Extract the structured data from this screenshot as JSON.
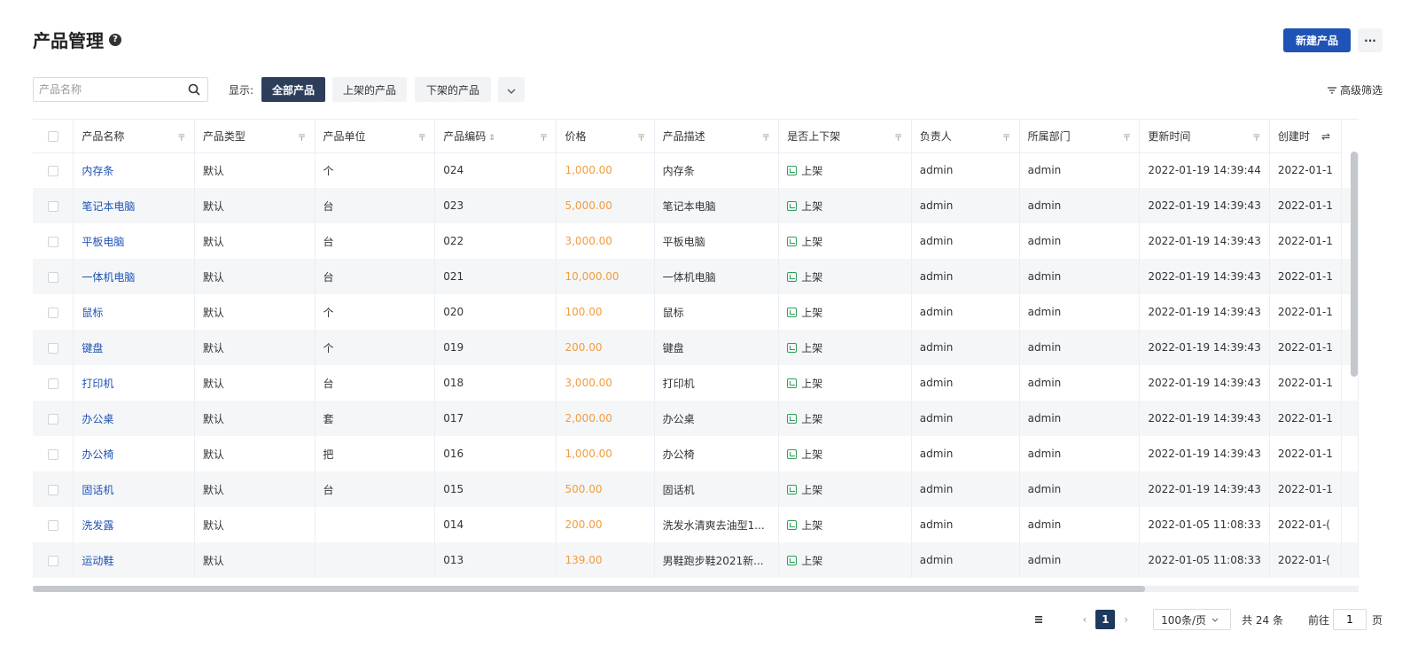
{
  "header": {
    "title": "产品管理",
    "new_button": "新建产品",
    "more_button": "···"
  },
  "toolbar": {
    "search_placeholder": "产品名称",
    "filter_label": "显示:",
    "filters": [
      "全部产品",
      "上架的产品",
      "下架的产品"
    ],
    "advanced_filter": "高级筛选"
  },
  "table": {
    "columns": [
      "产品名称",
      "产品类型",
      "产品单位",
      "产品编码",
      "价格",
      "产品描述",
      "是否上下架",
      "负责人",
      "所属部门",
      "更新时间",
      "创建时"
    ],
    "rows": [
      {
        "name": "内存条",
        "type": "默认",
        "unit": "个",
        "code": "024",
        "price": "1,000.00",
        "desc": "内存条",
        "status": "上架",
        "owner": "admin",
        "dept": "admin",
        "updated": "2022-01-19 14:39:44",
        "created": "2022-01-1"
      },
      {
        "name": "笔记本电脑",
        "type": "默认",
        "unit": "台",
        "code": "023",
        "price": "5,000.00",
        "desc": "笔记本电脑",
        "status": "上架",
        "owner": "admin",
        "dept": "admin",
        "updated": "2022-01-19 14:39:43",
        "created": "2022-01-1"
      },
      {
        "name": "平板电脑",
        "type": "默认",
        "unit": "台",
        "code": "022",
        "price": "3,000.00",
        "desc": "平板电脑",
        "status": "上架",
        "owner": "admin",
        "dept": "admin",
        "updated": "2022-01-19 14:39:43",
        "created": "2022-01-1"
      },
      {
        "name": "一体机电脑",
        "type": "默认",
        "unit": "台",
        "code": "021",
        "price": "10,000.00",
        "desc": "一体机电脑",
        "status": "上架",
        "owner": "admin",
        "dept": "admin",
        "updated": "2022-01-19 14:39:43",
        "created": "2022-01-1"
      },
      {
        "name": "鼠标",
        "type": "默认",
        "unit": "个",
        "code": "020",
        "price": "100.00",
        "desc": "鼠标",
        "status": "上架",
        "owner": "admin",
        "dept": "admin",
        "updated": "2022-01-19 14:39:43",
        "created": "2022-01-1"
      },
      {
        "name": "键盘",
        "type": "默认",
        "unit": "个",
        "code": "019",
        "price": "200.00",
        "desc": "键盘",
        "status": "上架",
        "owner": "admin",
        "dept": "admin",
        "updated": "2022-01-19 14:39:43",
        "created": "2022-01-1"
      },
      {
        "name": "打印机",
        "type": "默认",
        "unit": "台",
        "code": "018",
        "price": "3,000.00",
        "desc": "打印机",
        "status": "上架",
        "owner": "admin",
        "dept": "admin",
        "updated": "2022-01-19 14:39:43",
        "created": "2022-01-1"
      },
      {
        "name": "办公桌",
        "type": "默认",
        "unit": "套",
        "code": "017",
        "price": "2,000.00",
        "desc": "办公桌",
        "status": "上架",
        "owner": "admin",
        "dept": "admin",
        "updated": "2022-01-19 14:39:43",
        "created": "2022-01-1"
      },
      {
        "name": "办公椅",
        "type": "默认",
        "unit": "把",
        "code": "016",
        "price": "1,000.00",
        "desc": "办公椅",
        "status": "上架",
        "owner": "admin",
        "dept": "admin",
        "updated": "2022-01-19 14:39:43",
        "created": "2022-01-1"
      },
      {
        "name": "固话机",
        "type": "默认",
        "unit": "台",
        "code": "015",
        "price": "500.00",
        "desc": "固话机",
        "status": "上架",
        "owner": "admin",
        "dept": "admin",
        "updated": "2022-01-19 14:39:43",
        "created": "2022-01-1"
      },
      {
        "name": "洗发露",
        "type": "默认",
        "unit": "",
        "code": "014",
        "price": "200.00",
        "desc": "洗发水清爽去油型1...",
        "status": "上架",
        "owner": "admin",
        "dept": "admin",
        "updated": "2022-01-05 11:08:33",
        "created": "2022-01-("
      },
      {
        "name": "运动鞋",
        "type": "默认",
        "unit": "",
        "code": "013",
        "price": "139.00",
        "desc": "男鞋跑步鞋2021新...",
        "status": "上架",
        "owner": "admin",
        "dept": "admin",
        "updated": "2022-01-05 11:08:33",
        "created": "2022-01-("
      }
    ]
  },
  "pagination": {
    "current_page": "1",
    "page_size": "100条/页",
    "total": "共 24 条",
    "goto_prefix": "前往",
    "goto_value": "1",
    "goto_suffix": "页"
  },
  "colors": {
    "primary": "#1f53b5",
    "active_filter": "#2c3e5a",
    "price": "#f39c3c",
    "status_green": "#2e9e5a"
  }
}
